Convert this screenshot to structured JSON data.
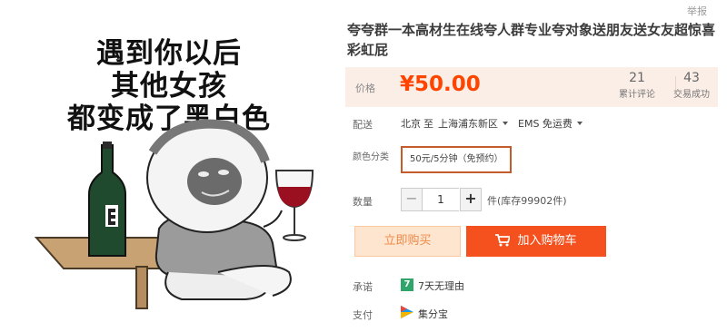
{
  "report_label": "举报",
  "meme": {
    "lines": [
      "遇到你以后",
      "其他女孩",
      "都变成了黑白色"
    ]
  },
  "product": {
    "title": "夸夸群一本高材生在线夸人群专业夸对象送朋友送女友超惊喜彩虹屁"
  },
  "price": {
    "label": "价格",
    "value": "¥50.00",
    "reviews_count": "21",
    "reviews_label": "累计评论",
    "sales_count": "43",
    "sales_label": "交易成功"
  },
  "shipping": {
    "label": "配送",
    "from": "北京",
    "to_word": "至",
    "destination": "上海浦东新区",
    "method": "EMS 免运费"
  },
  "color": {
    "label": "颜色分类",
    "option": "50元/5分钟（免预约）"
  },
  "quantity": {
    "label": "数量",
    "minus": "−",
    "value": "1",
    "plus": "+",
    "stock": "件(库存99902件)"
  },
  "actions": {
    "buy_now": "立即购买",
    "add_to_cart": "加入购物车"
  },
  "promise": {
    "label": "承诺",
    "icon_text": "7",
    "text": "7天无理由"
  },
  "payment": {
    "label": "支付",
    "text": "集分宝"
  },
  "colors": {
    "price": "#ff4400",
    "cart_button": "#f4511e",
    "buy_now_bg": "#fde5cf",
    "price_box_bg": "#fbeee6"
  }
}
